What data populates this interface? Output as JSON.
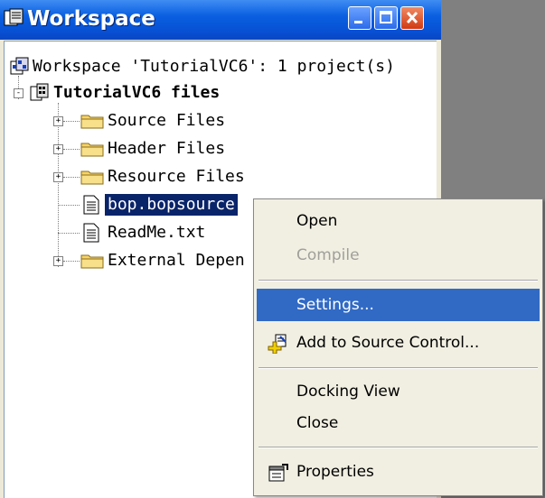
{
  "window": {
    "title": "Workspace",
    "controls": [
      "minimize",
      "maximize",
      "close"
    ]
  },
  "tree": {
    "root_label": "Workspace 'TutorialVC6': 1 project(s)",
    "project_label": "TutorialVC6 files",
    "items": [
      {
        "label": "Source Files",
        "type": "folder",
        "expander": "+"
      },
      {
        "label": "Header Files",
        "type": "folder",
        "expander": "+"
      },
      {
        "label": "Resource Files",
        "type": "folder",
        "expander": "+"
      },
      {
        "label": "bop.bopsource",
        "type": "file",
        "selected": true
      },
      {
        "label": "ReadMe.txt",
        "type": "file"
      },
      {
        "label": "External Depen",
        "type": "folder",
        "expander": "+"
      }
    ]
  },
  "context_menu": {
    "items": [
      {
        "label": "Open",
        "enabled": true
      },
      {
        "label": "Compile",
        "enabled": false
      },
      {
        "label": "Settings...",
        "enabled": true,
        "highlighted": true
      },
      {
        "label": "Add to Source Control...",
        "enabled": true,
        "icon": "source-control-icon"
      },
      {
        "label": "Docking View",
        "enabled": true
      },
      {
        "label": "Close",
        "enabled": true
      },
      {
        "label": "Properties",
        "enabled": true,
        "icon": "properties-icon"
      }
    ]
  },
  "colors": {
    "titlebar": "#0a5fe0",
    "selection": "#0a246a",
    "menu_highlight": "#316ac5",
    "menu_background": "#f1efe2",
    "backdrop": "#808080"
  }
}
